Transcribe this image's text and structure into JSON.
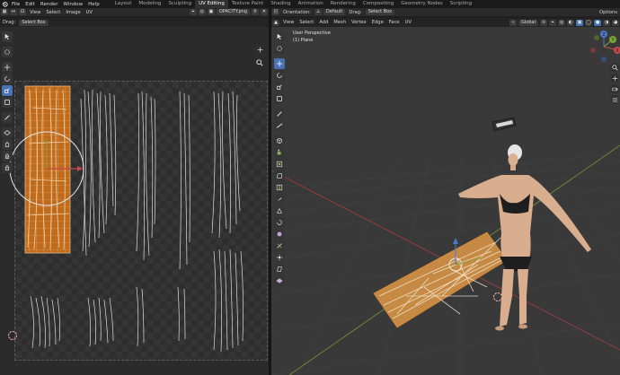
{
  "menubar": {
    "items": [
      "File",
      "Edit",
      "Render",
      "Window",
      "Help"
    ],
    "workspaces": [
      {
        "label": "Layout",
        "active": false
      },
      {
        "label": "Modeling",
        "active": false
      },
      {
        "label": "Sculpting",
        "active": false
      },
      {
        "label": "UV Editing",
        "active": true
      },
      {
        "label": "Texture Paint",
        "active": false
      },
      {
        "label": "Shading",
        "active": false
      },
      {
        "label": "Animation",
        "active": false
      },
      {
        "label": "Rendering",
        "active": false
      },
      {
        "label": "Compositing",
        "active": false
      },
      {
        "label": "Geometry Nodes",
        "active": false
      },
      {
        "label": "Scripting",
        "active": false
      }
    ]
  },
  "uv_editor": {
    "header": {
      "view": "View",
      "select": "Select",
      "image": "Image",
      "uv": "UV",
      "image_name": "OPACITY.png"
    },
    "subheader": {
      "drag_label": "Drag:",
      "drag_mode": "Select Box"
    }
  },
  "viewport": {
    "header": {
      "orientation_label": "Orientation:",
      "orientation_value": "Default",
      "drag_label": "Drag:",
      "drag_mode": "Select Box",
      "options": "Options",
      "transform_orientation": "Global"
    },
    "subheader": {
      "view": "View",
      "select": "Select",
      "add": "Add",
      "mesh": "Mesh",
      "vertex": "Vertex",
      "edge": "Edge",
      "face": "Face",
      "uv": "UV"
    },
    "info": {
      "perspective": "User Perspective",
      "object": "(1) Plane"
    },
    "gizmo": {
      "x": "X",
      "y": "Y",
      "z": "Z"
    }
  },
  "colors": {
    "accent": "#4772b3",
    "uv_island": "#c06a1c",
    "x_axis": "#c44b4b",
    "y_axis": "#7aa43a",
    "z_axis": "#4a79c8"
  }
}
